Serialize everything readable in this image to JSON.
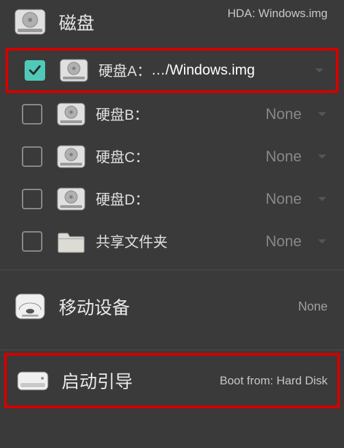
{
  "disks": {
    "title": "磁盘",
    "subtitle": "HDA: Windows.img",
    "items": [
      {
        "label": "硬盘A：",
        "value": "…/Windows.img",
        "checked": true,
        "hasDropdown": true
      },
      {
        "label": "硬盘B：",
        "value": "None",
        "checked": false,
        "hasDropdown": true,
        "isNone": true
      },
      {
        "label": "硬盘C：",
        "value": "None",
        "checked": false,
        "hasDropdown": true,
        "isNone": true
      },
      {
        "label": "硬盘D：",
        "value": "None",
        "checked": false,
        "hasDropdown": true,
        "isNone": true
      },
      {
        "label": "共享文件夹",
        "value": "None",
        "checked": false,
        "hasDropdown": true,
        "isNone": true,
        "isFolder": true
      }
    ]
  },
  "removable": {
    "title": "移动设备",
    "value": "None"
  },
  "boot": {
    "title": "启动引导",
    "subtitle": "Boot from: Hard Disk"
  }
}
